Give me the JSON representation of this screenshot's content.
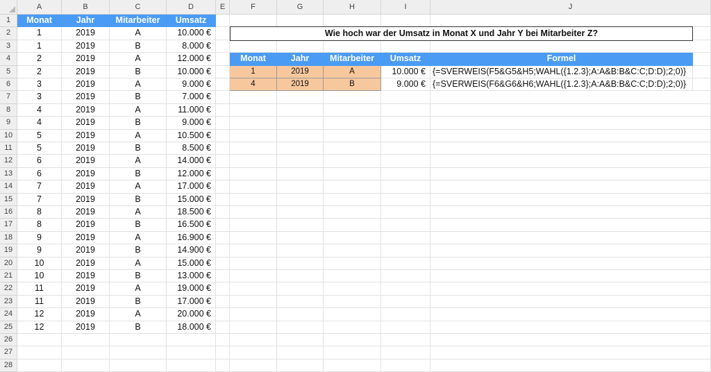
{
  "columns": [
    "A",
    "B",
    "C",
    "D",
    "E",
    "F",
    "G",
    "H",
    "I",
    "J"
  ],
  "rows": [
    "1",
    "2",
    "3",
    "4",
    "5",
    "6",
    "7",
    "8",
    "9",
    "10",
    "11",
    "12",
    "13",
    "14",
    "15",
    "16",
    "17",
    "18",
    "19",
    "20",
    "21",
    "22",
    "23",
    "24",
    "25",
    "26",
    "27",
    "28"
  ],
  "left_table": {
    "headers": [
      "Monat",
      "Jahr",
      "Mitarbeiter",
      "Umsatz"
    ],
    "rows": [
      [
        "1",
        "2019",
        "A",
        "10.000 €"
      ],
      [
        "1",
        "2019",
        "B",
        "8.000 €"
      ],
      [
        "2",
        "2019",
        "A",
        "12.000 €"
      ],
      [
        "2",
        "2019",
        "B",
        "10.000 €"
      ],
      [
        "3",
        "2019",
        "A",
        "9.000 €"
      ],
      [
        "3",
        "2019",
        "B",
        "7.000 €"
      ],
      [
        "4",
        "2019",
        "A",
        "11.000 €"
      ],
      [
        "4",
        "2019",
        "B",
        "9.000 €"
      ],
      [
        "5",
        "2019",
        "A",
        "10.500 €"
      ],
      [
        "5",
        "2019",
        "B",
        "8.500 €"
      ],
      [
        "6",
        "2019",
        "A",
        "14.000 €"
      ],
      [
        "6",
        "2019",
        "B",
        "12.000 €"
      ],
      [
        "7",
        "2019",
        "A",
        "17.000 €"
      ],
      [
        "7",
        "2019",
        "B",
        "15.000 €"
      ],
      [
        "8",
        "2019",
        "A",
        "18.500 €"
      ],
      [
        "8",
        "2019",
        "B",
        "16.500 €"
      ],
      [
        "9",
        "2019",
        "A",
        "16.900 €"
      ],
      [
        "9",
        "2019",
        "B",
        "14.900 €"
      ],
      [
        "10",
        "2019",
        "A",
        "15.000 €"
      ],
      [
        "10",
        "2019",
        "B",
        "13.000 €"
      ],
      [
        "11",
        "2019",
        "A",
        "19.000 €"
      ],
      [
        "11",
        "2019",
        "B",
        "17.000 €"
      ],
      [
        "12",
        "2019",
        "A",
        "20.000 €"
      ],
      [
        "12",
        "2019",
        "B",
        "18.000 €"
      ]
    ]
  },
  "question": "Wie hoch war der Umsatz in Monat X und Jahr Y bei Mitarbeiter Z?",
  "right_table": {
    "headers": [
      "Monat",
      "Jahr",
      "Mitarbeiter",
      "Umsatz",
      "Formel"
    ],
    "rows": [
      {
        "monat": "1",
        "jahr": "2019",
        "mitarbeiter": "A",
        "umsatz": "10.000 €",
        "formel": "{=SVERWEIS(F5&G5&H5;WAHL({1.2.3};A:A&B:B&C:C;D:D);2;0)}"
      },
      {
        "monat": "4",
        "jahr": "2019",
        "mitarbeiter": "B",
        "umsatz": "9.000 €",
        "formel": "{=SVERWEIS(F6&G6&H6;WAHL({1.2.3};A:A&B:B&C:C;D:D);2;0)}"
      }
    ]
  },
  "colors": {
    "header_blue": "#4a9bf3",
    "input_orange": "#f7c79d",
    "grid": "#e1e1e1",
    "header_bg": "#efefef"
  }
}
